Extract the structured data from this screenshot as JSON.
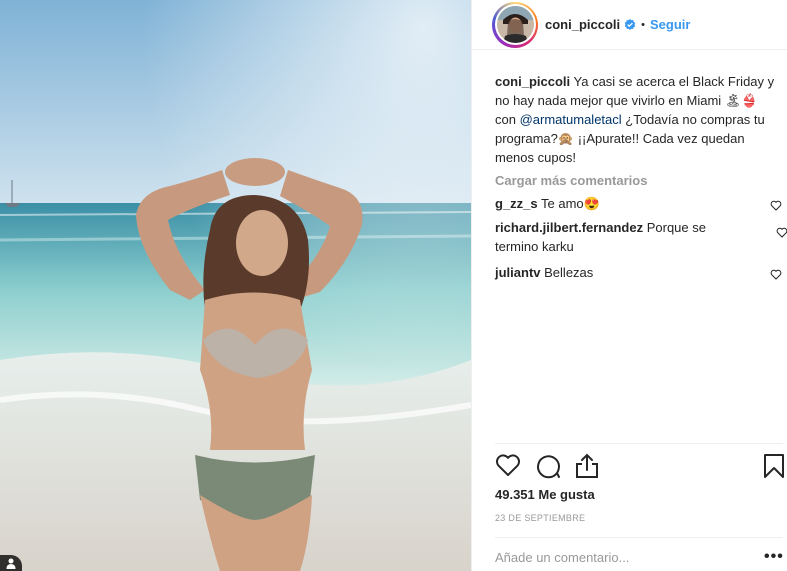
{
  "post": {
    "username": "coni_piccoli",
    "follow_label": "Seguir",
    "separator": "•",
    "verified_icon": "verified-badge-icon"
  },
  "caption": {
    "username": "coni_piccoli",
    "text_1": "Ya casi se acerca el Black Friday y no hay nada mejor que vivirlo en Miami",
    "emoji_1": "🏝👙",
    "text_2": "con",
    "mention": "@armatumaletacl",
    "text_3": "¿Todavía no compras tu programa?",
    "emoji_2": "🙊",
    "text_4": "¡¡Apurate!! Cada vez quedan menos cupos!"
  },
  "load_more_label": "Cargar más comentarios",
  "comments": [
    {
      "username": "g_zz_s",
      "text": "Te amo😍"
    },
    {
      "username": "richard.jilbert.fernandez",
      "text": "Porque se termino karku"
    },
    {
      "username": "juliantv",
      "text": "Bellezas"
    }
  ],
  "likes": "49.351 Me gusta",
  "date": "23 DE SEPTIEMBRE",
  "comment_input": {
    "placeholder": "Añade un comentario..."
  },
  "more_label": "•••",
  "colors": {
    "link": "#3897f0",
    "text": "#262626",
    "muted": "#999999",
    "mention": "#003569"
  }
}
